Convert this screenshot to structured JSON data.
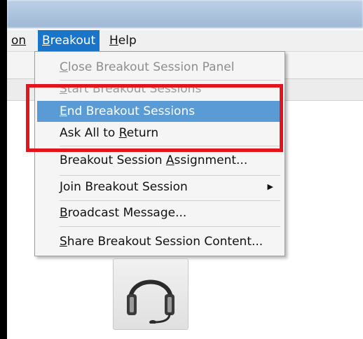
{
  "menubar": {
    "items": [
      {
        "label": "on",
        "active": false
      },
      {
        "label": "Breakout",
        "active": true
      },
      {
        "label": "Help",
        "active": false
      }
    ]
  },
  "dropdown": {
    "items": [
      {
        "label": "Close Breakout Session Panel",
        "state": "disabled"
      },
      {
        "label": "Start Breakout Sessions",
        "state": "disabled"
      },
      {
        "label": "End Breakout Sessions",
        "state": "highlighted"
      },
      {
        "label": "Ask All to Return",
        "state": "enabled"
      },
      {
        "label": "Breakout Session Assignment...",
        "state": "enabled"
      },
      {
        "label": "Join Breakout Session",
        "state": "enabled",
        "submenu": true
      },
      {
        "label": "Broadcast Message...",
        "state": "enabled"
      },
      {
        "label": "Share Breakout Session Content...",
        "state": "enabled"
      }
    ]
  },
  "icons": {
    "headset": "headset-icon",
    "submenu_arrow": "chevron-right-icon"
  },
  "colors": {
    "menu_active": "#1a74c8",
    "item_highlight": "#5b9bd5",
    "annotation_box": "#e3151c"
  }
}
